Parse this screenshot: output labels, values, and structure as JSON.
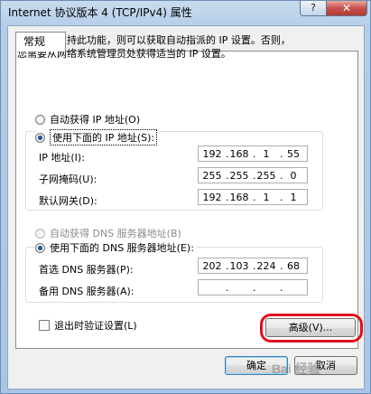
{
  "window": {
    "title": "Internet 协议版本 4 (TCP/IPv4) 属性",
    "help_btn": "?",
    "close_btn": "✕"
  },
  "tab": {
    "label": "常规"
  },
  "description": {
    "line1": "如果网络支持此功能，则可以获取自动指派的 IP 设置。否则，",
    "line2": "您需要从网络系统管理员处获得适当的 IP 设置。"
  },
  "ip": {
    "auto_label": "自动获得 IP 地址(O)",
    "manual_label": "使用下面的 IP 地址(S):",
    "address_label": "IP 地址(I):",
    "address": [
      "192",
      "168",
      "1",
      "55"
    ],
    "mask_label": "子网掩码(U):",
    "mask": [
      "255",
      "255",
      "255",
      "0"
    ],
    "gateway_label": "默认网关(D):",
    "gateway": [
      "192",
      "168",
      "1",
      "1"
    ]
  },
  "dns": {
    "auto_label": "自动获得 DNS 服务器地址(B)",
    "manual_label": "使用下面的 DNS 服务器地址(E):",
    "preferred_label": "首选 DNS 服务器(P):",
    "preferred": [
      "202",
      "103",
      "224",
      "68"
    ],
    "alternate_label": "备用 DNS 服务器(A):",
    "alternate": [
      "",
      "",
      "",
      ""
    ]
  },
  "validate_label": "退出时验证设置(L)",
  "buttons": {
    "advanced": "高级(V)...",
    "ok": "确定",
    "cancel": "取消"
  },
  "watermark": "Bai 经验"
}
